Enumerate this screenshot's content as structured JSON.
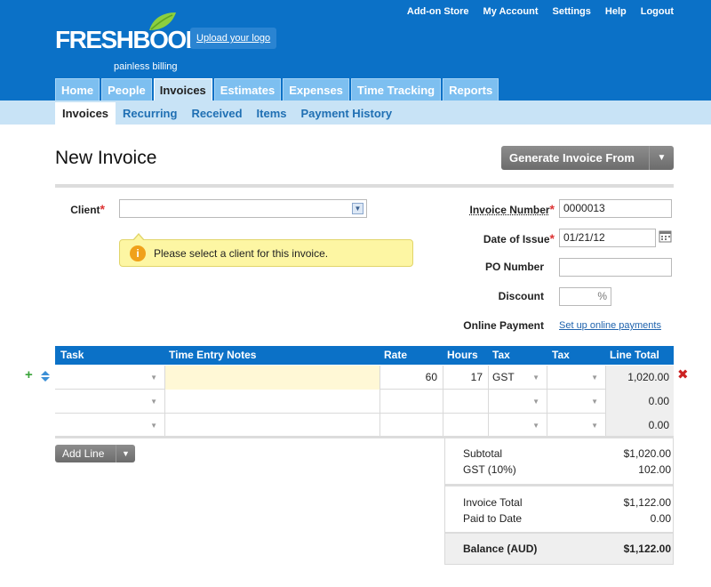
{
  "header": {
    "top_links": [
      "Add-on Store",
      "My Account",
      "Settings",
      "Help",
      "Logout"
    ],
    "logo_text": "FRESHBOOKS",
    "logo_tagline": "painless billing",
    "upload_logo": "Upload your logo"
  },
  "nav": {
    "tabs": [
      "Home",
      "People",
      "Invoices",
      "Estimates",
      "Expenses",
      "Time Tracking",
      "Reports"
    ],
    "active_tab": "Invoices",
    "subtabs": [
      "Invoices",
      "Recurring",
      "Received",
      "Items",
      "Payment History"
    ]
  },
  "page": {
    "title": "New Invoice",
    "generate_button": "Generate Invoice From"
  },
  "form": {
    "client_label": "Client",
    "client_value": "",
    "tooltip": "Please select a client for this invoice.",
    "invoice_number_label": "Invoice Number",
    "invoice_number": "0000013",
    "date_label": "Date of Issue",
    "date": "01/21/12",
    "po_label": "PO Number",
    "po_value": "",
    "discount_label": "Discount",
    "discount_unit": "%",
    "online_payment_label": "Online Payment",
    "online_payment_link": "Set up online payments"
  },
  "table": {
    "headers": [
      "Task",
      "Time Entry Notes",
      "Rate",
      "Hours",
      "Tax",
      "Tax",
      "Line Total"
    ],
    "rows": [
      {
        "task": "",
        "notes": "",
        "rate": "60",
        "hours": "17",
        "tax1": "GST",
        "tax2": "",
        "total": "1,020.00"
      },
      {
        "task": "",
        "notes": "",
        "rate": "",
        "hours": "",
        "tax1": "",
        "tax2": "",
        "total": "0.00"
      },
      {
        "task": "",
        "notes": "",
        "rate": "",
        "hours": "",
        "tax1": "",
        "tax2": "",
        "total": "0.00"
      }
    ]
  },
  "add_line": "Add Line",
  "summary": {
    "subtotal_label": "Subtotal",
    "subtotal": "$1,020.00",
    "gst_label": "GST (10%)",
    "gst": "102.00",
    "invoice_total_label": "Invoice Total",
    "invoice_total": "$1,122.00",
    "paid_label": "Paid to Date",
    "paid": "0.00",
    "balance_label": "Balance (AUD)",
    "balance": "$1,122.00"
  },
  "colors": {
    "brand": "#0b71c7",
    "subnav": "#c8e3f6",
    "highlight": "#fff8d6"
  }
}
